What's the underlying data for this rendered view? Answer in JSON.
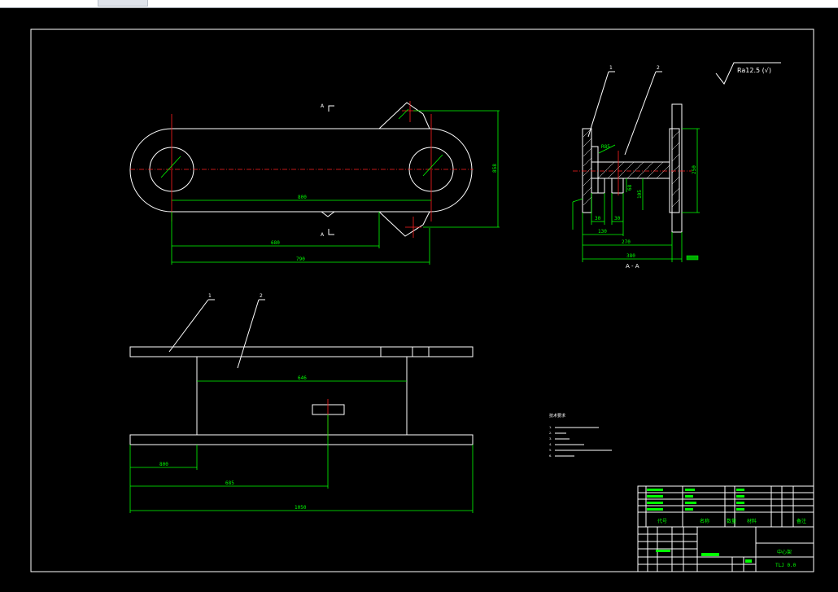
{
  "dimensions": {
    "d800": "800",
    "d680": "680",
    "d790": "790",
    "d858": "858",
    "d646": "646",
    "d800b": "800",
    "d685": "685",
    "d1050": "1050",
    "d250": "250",
    "d30a": "30",
    "d30b": "30",
    "d130": "130",
    "d270": "270",
    "d380": "380",
    "d68": "68",
    "d105": "105",
    "d85": "R85"
  },
  "labels": {
    "section_a_top": "A",
    "section_a_bottom": "A",
    "section_title": "A - A",
    "roughness": "Ra12.5 (√)",
    "leader1": "1",
    "leader2": "2",
    "leader3": "1",
    "leader4": "2"
  },
  "notes": {
    "title": "技术要求",
    "lines": [
      "1.  ",
      "2.  ",
      "3.  ",
      "4.  ",
      "5.  ",
      "6.  "
    ]
  },
  "title_block": {
    "col_code": "代号",
    "col_name": "名称",
    "col_qty": "数量",
    "col_material": "材料",
    "col_note": "备注",
    "drawing_name": "中心架",
    "drawing_no": "TLJ 0.0"
  }
}
